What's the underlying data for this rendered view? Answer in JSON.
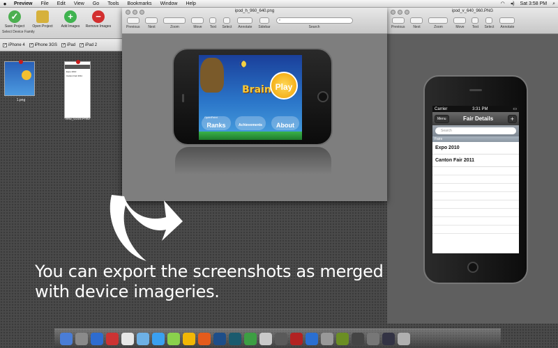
{
  "menubar": {
    "apple": "",
    "items": [
      "Preview",
      "File",
      "Edit",
      "View",
      "Go",
      "Tools",
      "Bookmarks",
      "Window",
      "Help"
    ],
    "clock": "Sat 3:58 PM"
  },
  "app_toolbar": {
    "buttons": [
      {
        "label": "Save Project",
        "icon": "save-icon",
        "color": "#4caf50"
      },
      {
        "label": "Open Project",
        "icon": "folder-icon",
        "color": "#d6b13c"
      },
      {
        "label": "Add Images",
        "icon": "plus-icon",
        "color": "#3fb34f"
      },
      {
        "label": "Remove Images",
        "icon": "minus-icon",
        "color": "#d32f2f"
      }
    ],
    "device_family_label": "Select Device Family",
    "devices": [
      "iPhone 4",
      "iPhone 3GS",
      "iPad",
      "iPad 2"
    ]
  },
  "thumbnails": [
    {
      "caption": "1.png"
    },
    {
      "caption": "IMG_0316.PNG"
    }
  ],
  "preview_window_1": {
    "title": "ipod_h_960_640.png",
    "tools": [
      "Previous",
      "Next",
      "Zoom",
      "Move",
      "Text",
      "Select",
      "Annotate",
      "Sidebar",
      "Search"
    ],
    "game": {
      "play": "Play",
      "brain": "Brain",
      "ranks": "Ranks",
      "achievements": "Achievements",
      "about": "About",
      "openfeint": "OpenFeint"
    }
  },
  "preview_window_2": {
    "title": "ipod_v_640_960.PNG",
    "tools": [
      "Previous",
      "Next",
      "Zoom",
      "Move",
      "Text",
      "Select",
      "Annotate"
    ],
    "ios": {
      "carrier": "Carrier",
      "time": "3:31 PM",
      "nav_title": "Fair Details",
      "menu_button": "Menu",
      "add_button": "+",
      "search_placeholder": "Search",
      "section": "Fairs",
      "rows": [
        "Expo 2010",
        "Canton Fair 2011"
      ]
    }
  },
  "caption": {
    "line1": "You can export the screenshots as merged",
    "line2": "with device imageries."
  }
}
